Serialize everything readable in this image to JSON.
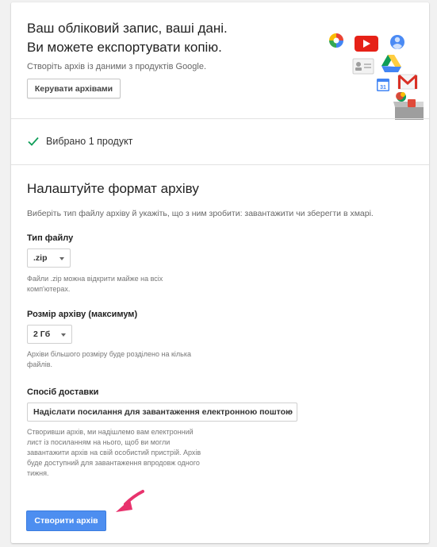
{
  "header": {
    "title_line1": "Ваш обліковий запис, ваші дані.",
    "title_line2": "Ви можете експортувати копію.",
    "subtitle": "Створіть архів із даними з продуктів Google.",
    "manage_button": "Керувати архівами",
    "illustration_icons": [
      "photos-icon",
      "youtube-icon",
      "account-icon",
      "contacts-icon",
      "drive-icon",
      "calendar-icon",
      "gmail-icon",
      "hangouts-icon",
      "archive-box-icon"
    ],
    "calendar_day": "31"
  },
  "selected": {
    "text": "Вибрано 1 продукт",
    "icon": "check-icon",
    "icon_color": "#0f9d58"
  },
  "format": {
    "title": "Налаштуйте формат архіву",
    "description": "Виберіть тип файлу архіву й укажіть, що з ним зробити: завантажити чи зберегти в хмарі.",
    "file_type": {
      "label": "Тип файлу",
      "value": ".zip",
      "hint_line1": "Файли .zip можна відкрити майже на всіх",
      "hint_line2": "комп'ютерах."
    },
    "archive_size": {
      "label": "Розмір архіву (максимум)",
      "value": "2 Гб",
      "hint_line1": "Архіви більшого розміру буде розділено на кілька",
      "hint_line2": "файлів."
    },
    "delivery": {
      "label": "Спосіб доставки",
      "value": "Надіслати посилання для завантаження електронною поштою",
      "hint_line1": "Створивши архів, ми надішлемо вам електронний",
      "hint_line2": "лист із посиланням на нього, щоб ви могли",
      "hint_line3": "завантажити архів на свій особистий пристрій. Архів",
      "hint_line4": "буде доступний для завантаження впродовж одного",
      "hint_line5": "тижня."
    },
    "create_button": "Створити архів"
  },
  "colors": {
    "primary_button": "#4d8ef0",
    "annotation_arrow": "#e8336d"
  }
}
